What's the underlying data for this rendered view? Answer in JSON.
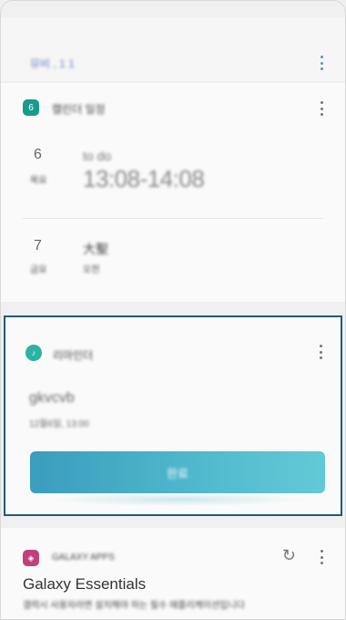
{
  "top_card": {
    "title": "뮤비 , 1 1"
  },
  "schedule_card": {
    "app_name": "캘린더 일정",
    "icon_text": "6",
    "event1": {
      "day_num": "6",
      "day_label": "목요",
      "title": "to do",
      "time": "13:08-14:08"
    },
    "event2": {
      "day_num": "7",
      "day_label": "금요",
      "title": "大聖",
      "sub": "오전"
    }
  },
  "reminder_card": {
    "app_name": "리마인더",
    "title": "gkvcvb",
    "subtitle": "12월6일, 13:00",
    "button_label": "완료"
  },
  "galaxy_apps_card": {
    "app_name": "GALAXY APPS",
    "title": "Galaxy Essentials",
    "description": "갤럭시 사용자라면 설치해야 하는 필수 애플리케이션입니다"
  },
  "colors": {
    "accent": "#3a9dbd",
    "selection_border": "#1f5a7a",
    "calendar_icon": "#1a9a88",
    "reminder_icon": "#2bb3a0",
    "galaxy_icon": "#c0407a"
  }
}
